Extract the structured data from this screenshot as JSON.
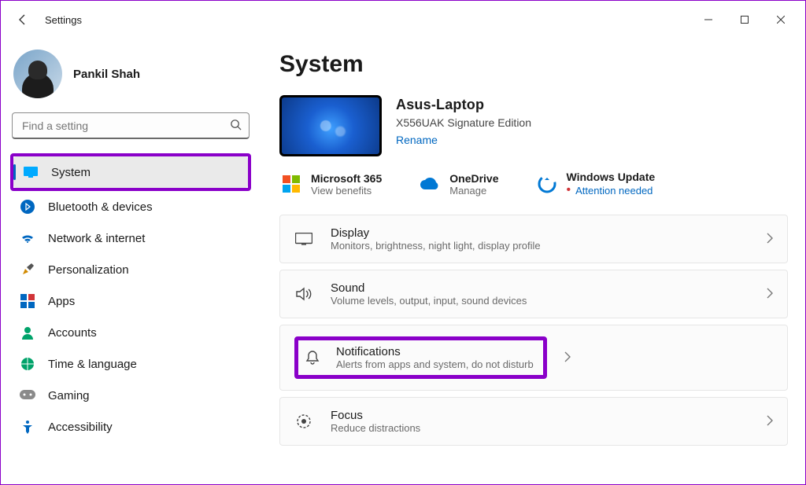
{
  "window": {
    "title": "Settings"
  },
  "profile": {
    "name": "Pankil Shah"
  },
  "search": {
    "placeholder": "Find a setting"
  },
  "nav": {
    "system": "System",
    "bluetooth": "Bluetooth & devices",
    "network": "Network & internet",
    "personalization": "Personalization",
    "apps": "Apps",
    "accounts": "Accounts",
    "time": "Time & language",
    "gaming": "Gaming",
    "accessibility": "Accessibility"
  },
  "page": {
    "title": "System"
  },
  "device": {
    "name": "Asus-Laptop",
    "model": "X556UAK Signature Edition",
    "rename": "Rename"
  },
  "services": {
    "m365": {
      "title": "Microsoft 365",
      "sub": "View benefits"
    },
    "onedrive": {
      "title": "OneDrive",
      "sub": "Manage"
    },
    "update": {
      "title": "Windows Update",
      "sub": "Attention needed"
    }
  },
  "cards": {
    "display": {
      "title": "Display",
      "sub": "Monitors, brightness, night light, display profile"
    },
    "sound": {
      "title": "Sound",
      "sub": "Volume levels, output, input, sound devices"
    },
    "notifications": {
      "title": "Notifications",
      "sub": "Alerts from apps and system, do not disturb"
    },
    "focus": {
      "title": "Focus",
      "sub": "Reduce distractions"
    }
  }
}
